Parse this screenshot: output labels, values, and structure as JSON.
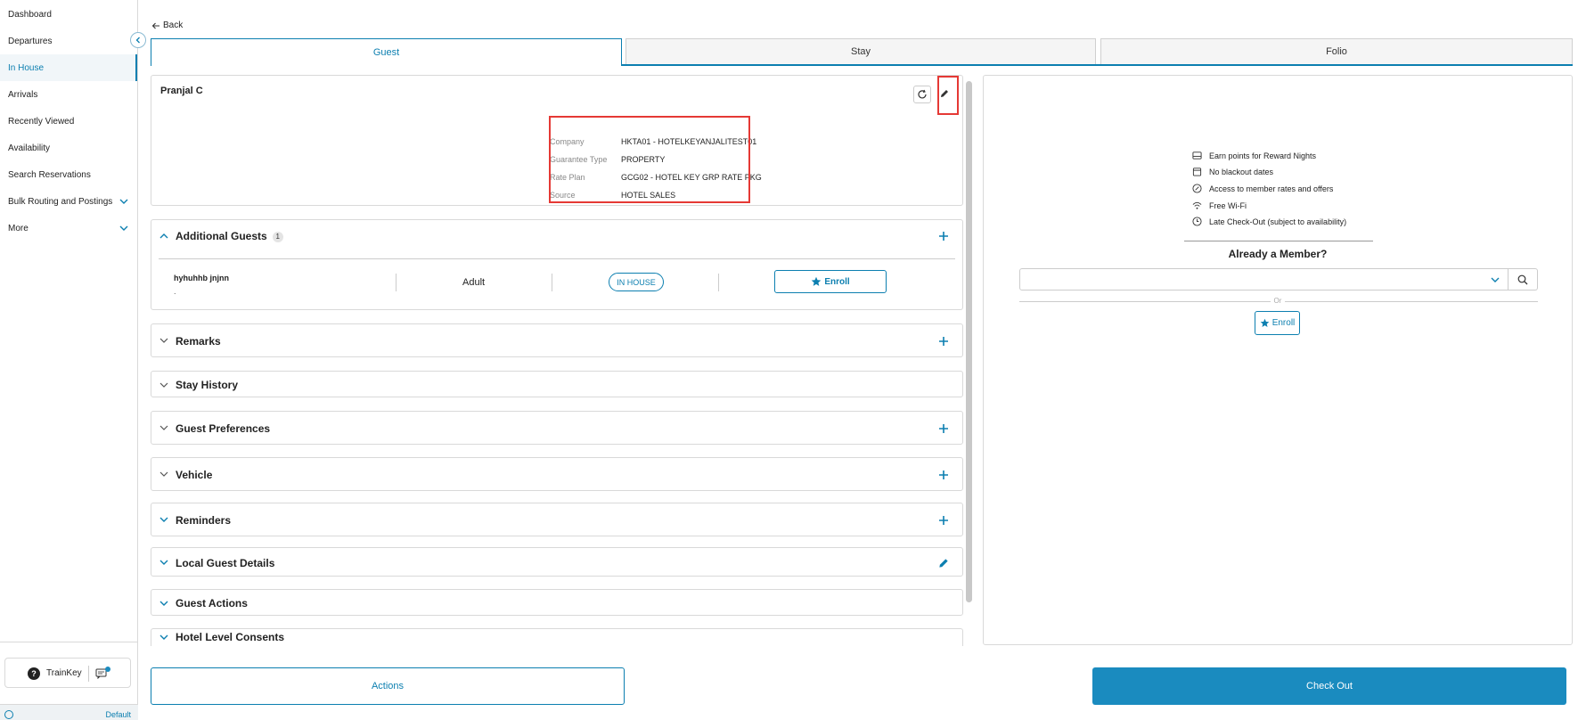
{
  "sidebar": {
    "items": [
      {
        "label": "Dashboard"
      },
      {
        "label": "Departures"
      },
      {
        "label": "In House"
      },
      {
        "label": "Arrivals"
      },
      {
        "label": "Recently Viewed"
      },
      {
        "label": "Availability"
      },
      {
        "label": "Search Reservations"
      },
      {
        "label": "Bulk Routing and Postings"
      },
      {
        "label": "More"
      }
    ],
    "active_item": "In House",
    "trainkey_label": "TrainKey",
    "chat_badge": "0",
    "footer_label": "Default"
  },
  "header": {
    "back_label": "Back",
    "tabs": [
      {
        "label": "Guest"
      },
      {
        "label": "Stay"
      },
      {
        "label": "Folio"
      }
    ],
    "active_tab": "Guest"
  },
  "guest": {
    "name": "Pranjal C",
    "details": [
      {
        "key": "Company",
        "value": "HKTA01 - HOTELKEYANJALITEST01"
      },
      {
        "key": "Guarantee Type",
        "value": "PROPERTY"
      },
      {
        "key": "Rate Plan",
        "value": "GCG02 - HOTEL KEY GRP RATE PKG"
      },
      {
        "key": "Source",
        "value": "HOTEL SALES"
      }
    ]
  },
  "additional_guests": {
    "title": "Additional Guests",
    "count": "1",
    "rows": [
      {
        "name": "hyhuhhb jnjnn",
        "sub": ".",
        "type": "Adult",
        "status": "IN HOUSE",
        "enroll_label": "Enroll"
      }
    ]
  },
  "sections": {
    "remarks": "Remarks",
    "stay_history": "Stay History",
    "guest_preferences": "Guest Preferences",
    "vehicle": "Vehicle",
    "reminders": "Reminders",
    "local_guest_details": "Local Guest Details",
    "guest_actions": "Guest Actions",
    "hotel_level_consents": "Hotel Level Consents"
  },
  "loyalty": {
    "benefits": [
      {
        "icon": "bed-icon",
        "text": "Earn points for Reward Nights"
      },
      {
        "icon": "calendar-icon",
        "text": "No blackout dates"
      },
      {
        "icon": "discount-icon",
        "text": "Access to member rates and offers"
      },
      {
        "icon": "wifi-icon",
        "text": "Free Wi-Fi"
      },
      {
        "icon": "clock-icon",
        "text": "Late Check-Out (subject to availability)"
      }
    ],
    "already_member": "Already a Member?",
    "or_label": "Or",
    "enroll_label": "Enroll"
  },
  "footer": {
    "actions_label": "Actions",
    "checkout_label": "Check Out"
  },
  "colors": {
    "accent": "#0c7fb0",
    "highlight": "#e53935",
    "checkout": "#1a8bbf"
  }
}
